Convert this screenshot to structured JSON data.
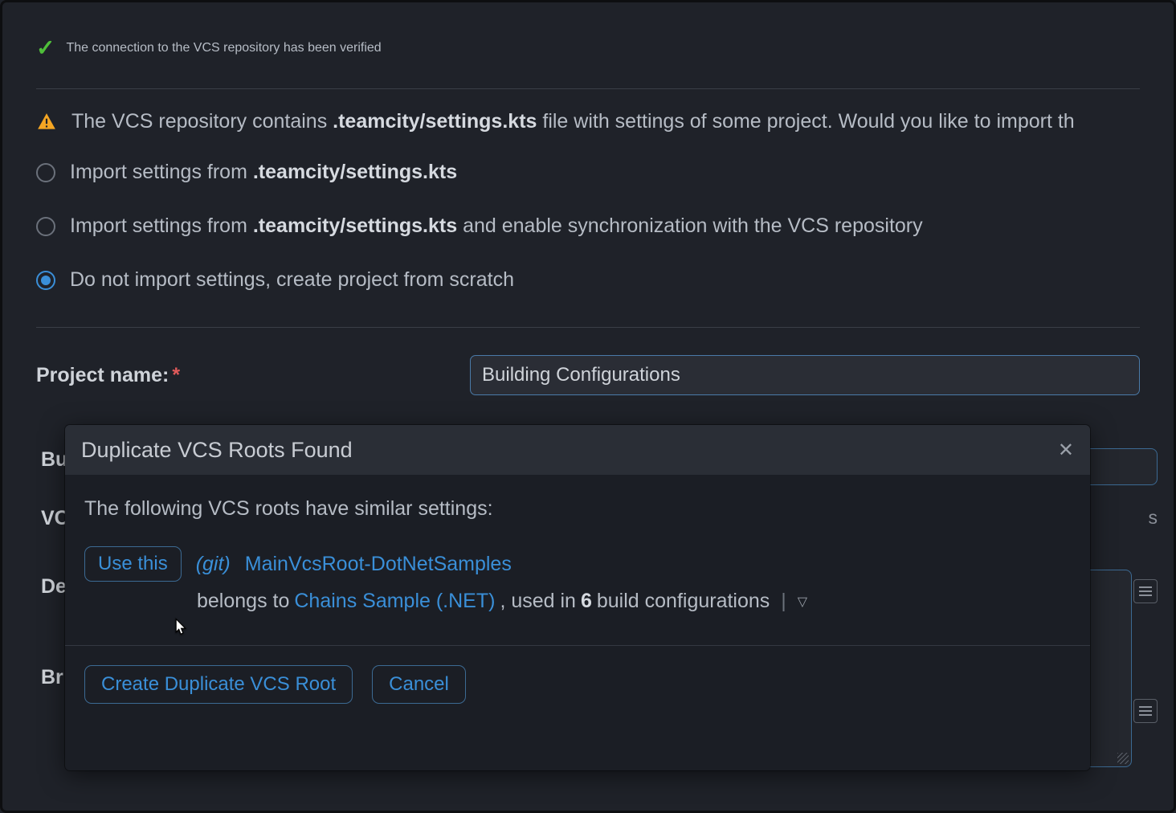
{
  "status": {
    "success_text": "The connection to the VCS repository has been verified"
  },
  "warning": {
    "prefix": "The VCS repository contains ",
    "filename": ".teamcity/settings.kts",
    "suffix": " file with settings of some project. Would you like to import th"
  },
  "radio": {
    "opt1_prefix": "Import settings from ",
    "opt1_file": ".teamcity/settings.kts",
    "opt2_prefix": "Import settings from ",
    "opt2_file": ".teamcity/settings.kts",
    "opt2_suffix": " and enable synchronization with the VCS repository",
    "opt3": "Do not import settings, create project from scratch"
  },
  "form": {
    "project_name_label": "Project name:",
    "project_name_value": "Building Configurations",
    "peek_bu": "Bu",
    "peek_vc": "VC",
    "peek_de": "De",
    "peek_br": "Br",
    "hint_s": "s"
  },
  "modal": {
    "title": "Duplicate VCS Roots Found",
    "intro": "The following VCS roots have similar settings:",
    "use_this": "Use this",
    "git_tag": "(git)",
    "root_name": "MainVcsRoot-DotNetSamples",
    "belongs_prefix": "belongs to ",
    "belongs_link": "Chains Sample (.NET)",
    "used_prefix": ", used in ",
    "used_count": "6",
    "used_suffix": " build configurations",
    "create_btn": "Create Duplicate VCS Root",
    "cancel_btn": "Cancel"
  }
}
